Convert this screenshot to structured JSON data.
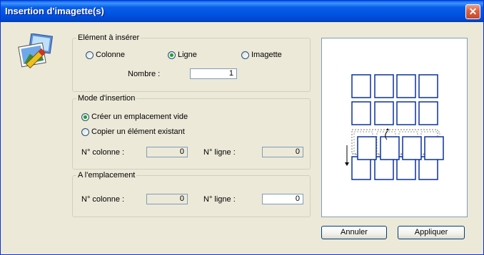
{
  "window": {
    "title": "Insertion d'imagette(s)",
    "close_glyph": "✕"
  },
  "element_group": {
    "legend": "Elément à insérer",
    "options": [
      {
        "label": "Colonne",
        "selected": false
      },
      {
        "label": "Ligne",
        "selected": true
      },
      {
        "label": "Imagette",
        "selected": false
      }
    ],
    "nombre_label": "Nombre :",
    "nombre_value": "1"
  },
  "mode_group": {
    "legend": "Mode d'insertion",
    "options": [
      {
        "label": "Créer un emplacement vide",
        "selected": true
      },
      {
        "label": "Copier un élément existant",
        "selected": false
      }
    ],
    "colonne_label": "N° colonne :",
    "colonne_value": "0",
    "ligne_label": "N° ligne :",
    "ligne_value": "0"
  },
  "location_group": {
    "legend": "A l'emplacement",
    "colonne_label": "N° colonne :",
    "colonne_value": "0",
    "ligne_label": "N° ligne :",
    "ligne_value": "0"
  },
  "buttons": {
    "cancel": "Annuler",
    "apply": "Appliquer"
  },
  "icons": {
    "app": "image-insert-icon",
    "close": "close-icon"
  },
  "colors": {
    "title_bar": "#0054E3",
    "accent_blue": "#0A30A0",
    "face": "#ECE9D8"
  }
}
